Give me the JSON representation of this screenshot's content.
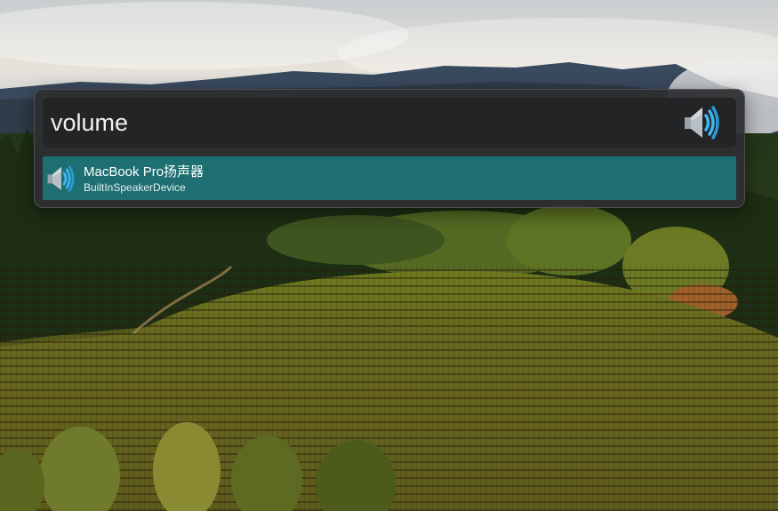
{
  "search": {
    "query": "volume",
    "icon": "speaker-volume-icon"
  },
  "results": [
    {
      "title": "MacBook Pro扬声器",
      "subtitle": "BuiltInSpeakerDevice",
      "icon": "speaker-volume-icon",
      "selected": true
    }
  ],
  "colors": {
    "panel": "#2e2f31",
    "search_bar": "#232426",
    "selection": "#1e6f72",
    "speaker_blue": "#3fb6f0"
  }
}
